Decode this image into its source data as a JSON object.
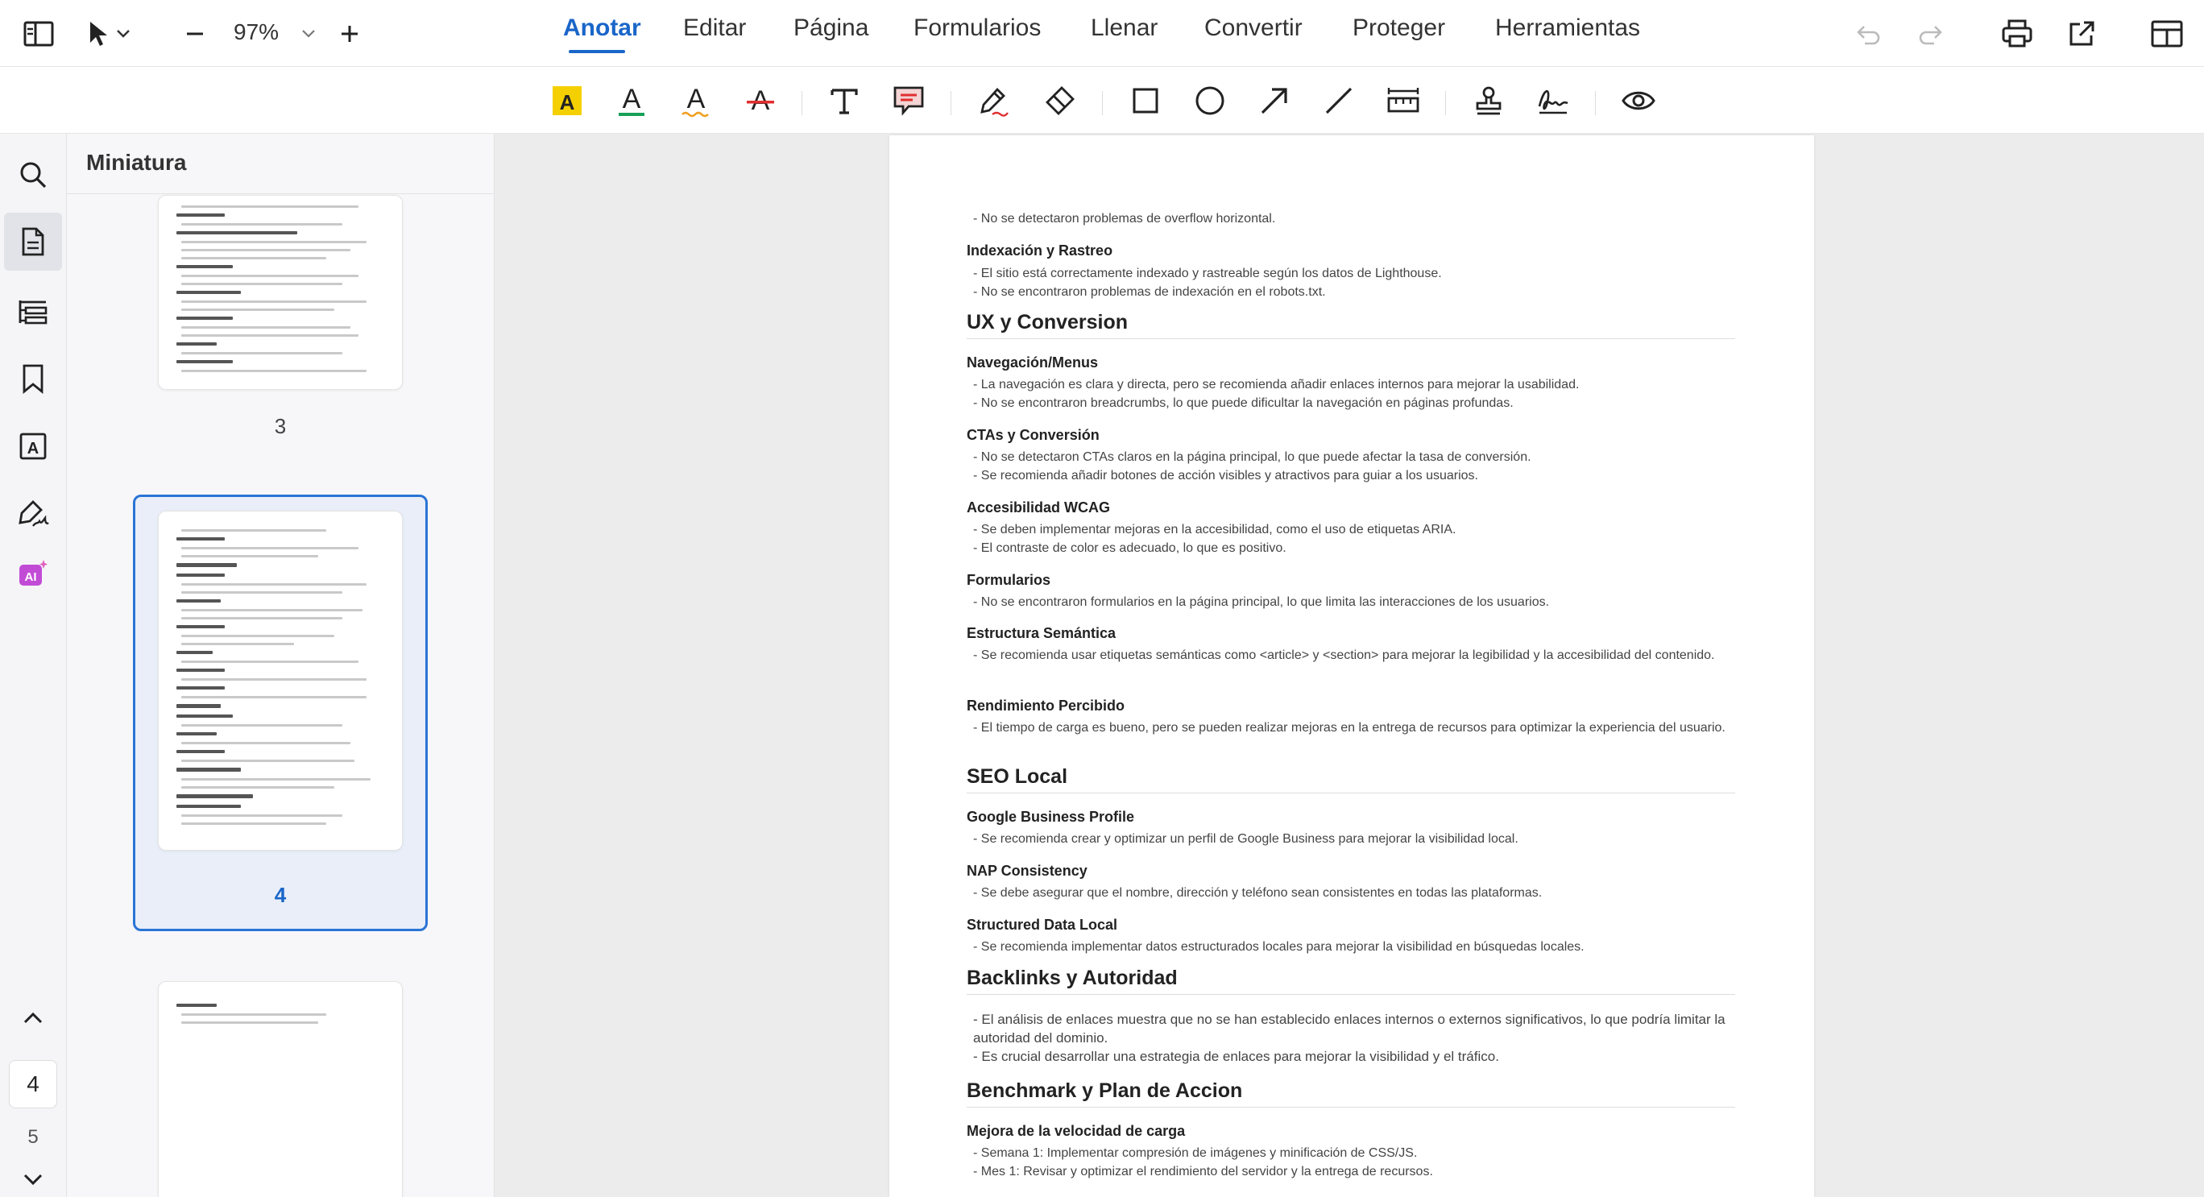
{
  "topbar": {
    "zoom": "97%",
    "menu": [
      "Anotar",
      "Editar",
      "Página",
      "Formularios",
      "Llenar",
      "Convertir",
      "Proteger",
      "Herramientas"
    ],
    "active_menu": "Anotar"
  },
  "icons": {
    "sidebar_toggle": "sidebar-toggle-icon",
    "select": "cursor-arrow-icon",
    "zoom_out": "minus-icon",
    "zoom_in": "plus-icon",
    "undo": "undo-icon",
    "redo": "redo-icon",
    "print": "printer-icon",
    "share": "external-share-icon",
    "layout": "layout-icon"
  },
  "colors": {
    "accent": "#1a66c9",
    "highlight": "#f5d000",
    "underline": "#18a058",
    "squiggly": "#f0a020",
    "strike": "#e03030",
    "comment": "#e03030",
    "ai": "#c24bd6"
  },
  "panel": {
    "title": "Miniatura",
    "thumbnails": [
      {
        "label": "3",
        "selected": false
      },
      {
        "label": "4",
        "selected": true
      },
      {
        "label": "",
        "selected": false
      }
    ]
  },
  "navigator": {
    "current_page": "4",
    "next_page": "5"
  },
  "document": {
    "blocks": [
      {
        "type": "text",
        "text": "- No se detectaron problemas de overflow horizontal."
      },
      {
        "type": "h2",
        "text": "Indexación y Rastreo"
      },
      {
        "type": "text",
        "text": "- El sitio está correctamente indexado y rastreable según los datos de Lighthouse."
      },
      {
        "type": "text",
        "text": "- No se encontraron problemas de indexación en el robots.txt."
      },
      {
        "type": "h1",
        "text": "UX y Conversion"
      },
      {
        "type": "h2",
        "text": "Navegación/Menus"
      },
      {
        "type": "text",
        "text": "- La navegación es clara y directa, pero se recomienda añadir enlaces internos para mejorar la usabilidad."
      },
      {
        "type": "text",
        "text": "- No se encontraron breadcrumbs, lo que puede dificultar la navegación en páginas profundas."
      },
      {
        "type": "h2",
        "text": "CTAs y Conversión"
      },
      {
        "type": "text",
        "text": "- No se detectaron CTAs claros en la página principal, lo que puede afectar la tasa de conversión."
      },
      {
        "type": "text",
        "text": "- Se recomienda añadir botones de acción visibles y atractivos para guiar a los usuarios."
      },
      {
        "type": "h2",
        "text": "Accesibilidad WCAG"
      },
      {
        "type": "text",
        "text": "- Se deben implementar mejoras en la accesibilidad, como el uso de etiquetas ARIA."
      },
      {
        "type": "text",
        "text": "- El contraste de color es adecuado, lo que es positivo."
      },
      {
        "type": "h2",
        "text": "Formularios"
      },
      {
        "type": "text",
        "text": "- No se encontraron formularios en la página principal, lo que limita las interacciones de los usuarios."
      },
      {
        "type": "h2",
        "text": "Estructura Semántica"
      },
      {
        "type": "text",
        "text": "- Se recomienda usar etiquetas semánticas como <article> y <section> para mejorar la legibilidad y la accesibilidad del contenido."
      },
      {
        "type": "h2",
        "text": "Rendimiento Percibido"
      },
      {
        "type": "text",
        "text": "- El tiempo de carga es bueno, pero se pueden realizar mejoras en la entrega de recursos para optimizar la experiencia del usuario."
      },
      {
        "type": "h1",
        "text": "SEO Local"
      },
      {
        "type": "h2",
        "text": "Google Business Profile"
      },
      {
        "type": "text",
        "text": "- Se recomienda crear y optimizar un perfil de Google Business para mejorar la visibilidad local."
      },
      {
        "type": "h2",
        "text": "NAP Consistency"
      },
      {
        "type": "text",
        "text": "- Se debe asegurar que el nombre, dirección y teléfono sean consistentes en todas las plataformas."
      },
      {
        "type": "h2",
        "text": "Structured Data Local"
      },
      {
        "type": "text",
        "text": "- Se recomienda implementar datos estructurados locales para mejorar la visibilidad en búsquedas locales."
      },
      {
        "type": "h1",
        "text": "Backlinks y Autoridad"
      },
      {
        "type": "text",
        "text": "- El análisis de enlaces muestra que no se han establecido enlaces internos o externos significativos, lo que podría limitar la autoridad del dominio."
      },
      {
        "type": "text",
        "text": "- Es crucial desarrollar una estrategia de enlaces para mejorar la visibilidad y el tráfico."
      },
      {
        "type": "h1",
        "text": "Benchmark y Plan de Accion"
      },
      {
        "type": "h2",
        "text": "Mejora de la velocidad de carga"
      },
      {
        "type": "text",
        "text": "- Semana 1: Implementar compresión de imágenes y minificación de CSS/JS."
      },
      {
        "type": "text",
        "text": "- Mes 1: Revisar y optimizar el rendimiento del servidor y la entrega de recursos."
      }
    ]
  }
}
